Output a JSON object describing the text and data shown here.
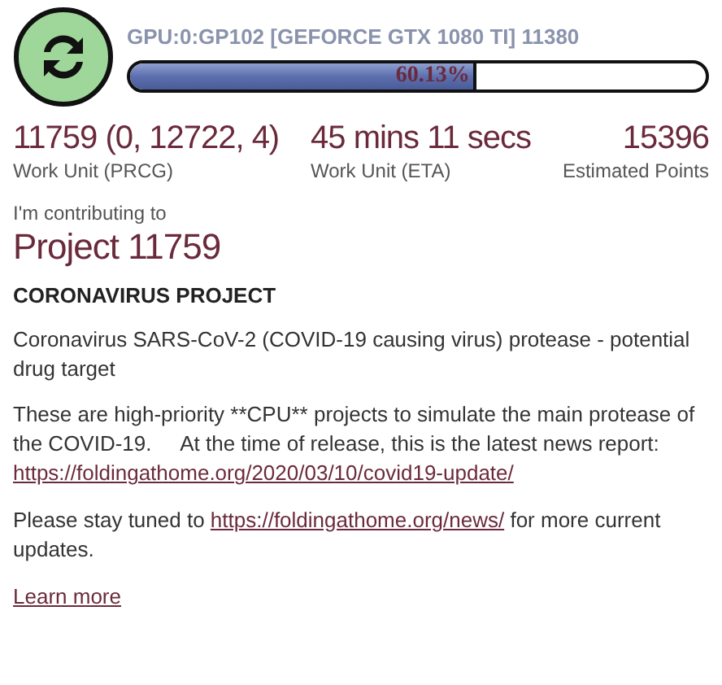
{
  "slot": {
    "title": "GPU:0:GP102 [GEFORCE GTX 1080 TI] 11380",
    "progress": {
      "level": 0.6013,
      "reading": "60.13%"
    }
  },
  "stats": [
    {
      "value": "11759 (0, 12722, 4)",
      "label": "Work Unit (PRCG)"
    },
    {
      "value": "45 mins 11 secs",
      "label": "Work Unit (ETA)"
    },
    {
      "value": "15396",
      "label": "Estimated Points"
    }
  ],
  "contributing": {
    "intro": "I'm contributing to",
    "project": "Project 11759"
  },
  "heading": "CORONAVIRUS PROJECT",
  "paragraphs": [
    {
      "text": "Coronavirus SARS-CoV-2 (COVID-19 causing virus) protease - potential drug target"
    },
    {
      "text": "These are high-priority **CPU** projects to simulate the main protease of the COVID-19.     At the time of release, this is the latest news report:  ",
      "link": "https://foldingathome.org/2020/03/10/covid19-update/"
    },
    {
      "text": "Please stay tuned to ",
      "link": "https://foldingathome.org/news/",
      "after": " for more current updates."
    }
  ],
  "learn_more": "Learn more"
}
